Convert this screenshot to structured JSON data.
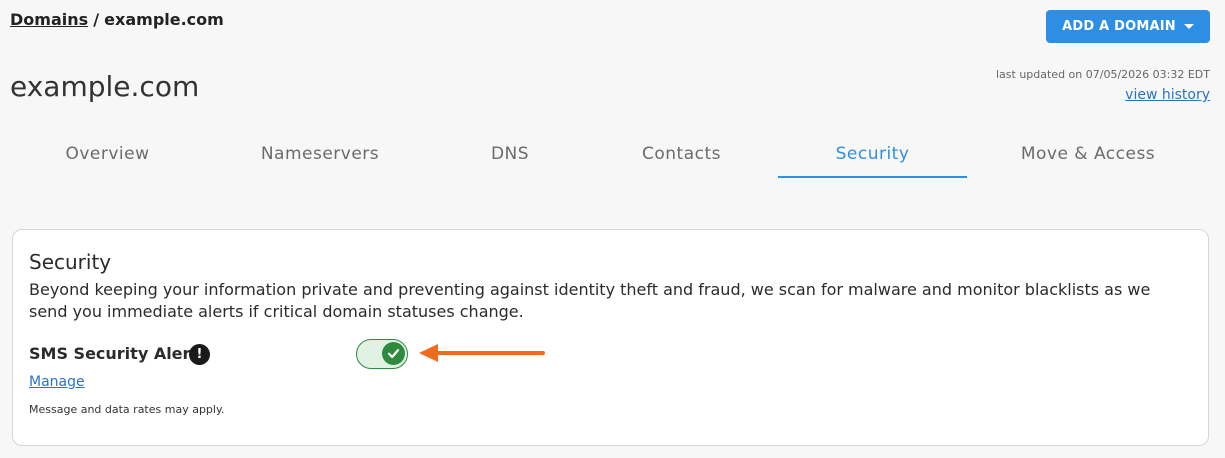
{
  "breadcrumb": {
    "root": "Domains",
    "separator": "/",
    "current": "example.com"
  },
  "header": {
    "add_domain_label": "ADD A DOMAIN",
    "domain_title": "example.com",
    "last_updated": "last updated on 07/05/2026 03:32 EDT",
    "view_history": "view history"
  },
  "tabs": [
    {
      "label": "Overview",
      "active": false
    },
    {
      "label": "Nameservers",
      "active": false
    },
    {
      "label": "DNS",
      "active": false
    },
    {
      "label": "Contacts",
      "active": false
    },
    {
      "label": "Security",
      "active": true
    },
    {
      "label": "Move & Access",
      "active": false
    }
  ],
  "security": {
    "title": "Security",
    "description": "Beyond keeping your information private and preventing against identity theft and fraud, we scan for malware and monitor blacklists as we send you immediate alerts if critical domain statuses change.",
    "sms_label": "SMS Security Alerts",
    "info_icon": "!",
    "sms_enabled": true,
    "manage_link": "Manage",
    "note": "Message and data rates may apply."
  },
  "colors": {
    "accent": "#2d8fe3",
    "toggle_on": "#2e8b3e",
    "annotation_arrow": "#f26a1b"
  },
  "icons": {
    "info": "exclamation-circle-icon",
    "toggle_check": "checkmark-icon",
    "dropdown": "caret-down-icon",
    "annotation": "arrow-left-icon"
  }
}
